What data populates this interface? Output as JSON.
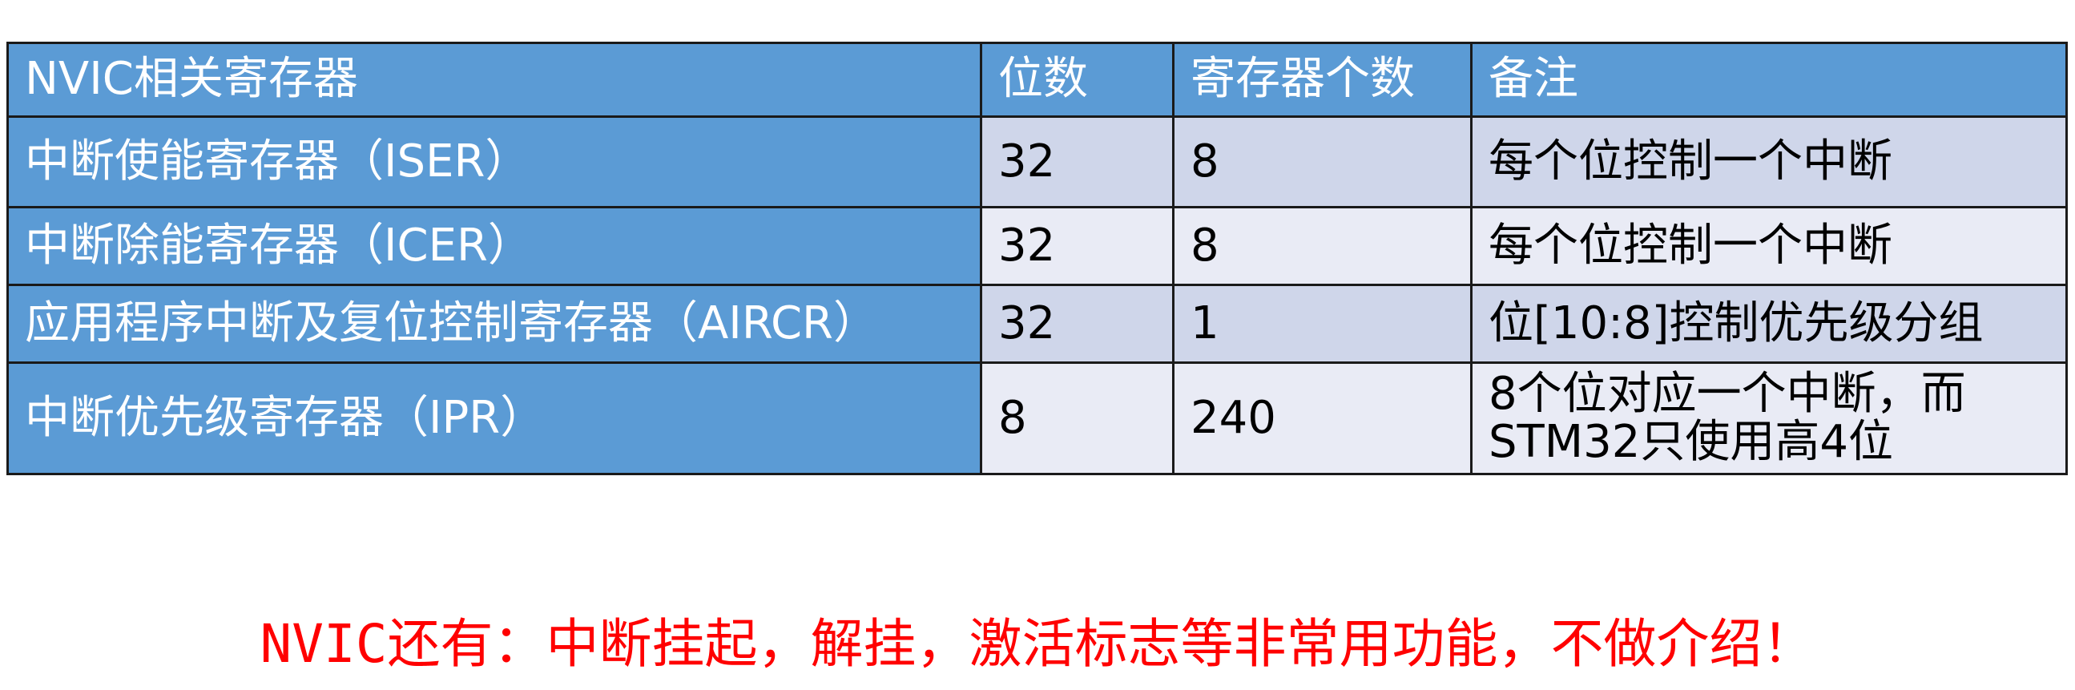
{
  "table": {
    "headers": {
      "register": "NVIC相关寄存器",
      "bits": "位数",
      "count": "寄存器个数",
      "remark": "备注"
    },
    "rows": [
      {
        "register": "中断使能寄存器（ISER）",
        "bits": "32",
        "count": "8",
        "remark": "每个位控制一个中断"
      },
      {
        "register": "中断除能寄存器（ICER）",
        "bits": "32",
        "count": "8",
        "remark": "每个位控制一个中断"
      },
      {
        "register": "应用程序中断及复位控制寄存器（AIRCR）",
        "bits": "32",
        "count": "1",
        "remark": "位[10:8]控制优先级分组"
      },
      {
        "register": "中断优先级寄存器（IPR）",
        "bits": "8",
        "count": "240",
        "remark_line1": "8个位对应一个中断，而",
        "remark_line2": "STM32只使用高4位"
      }
    ]
  },
  "footer": {
    "text": "NVIC还有：中断挂起，解挂，激活标志等非常用功能，不做介绍！"
  },
  "colors": {
    "header_blue": "#5b9bd5",
    "row_dark": "#cfd6ea",
    "row_light": "#e9ebf5",
    "footer_red": "#ff0000"
  }
}
